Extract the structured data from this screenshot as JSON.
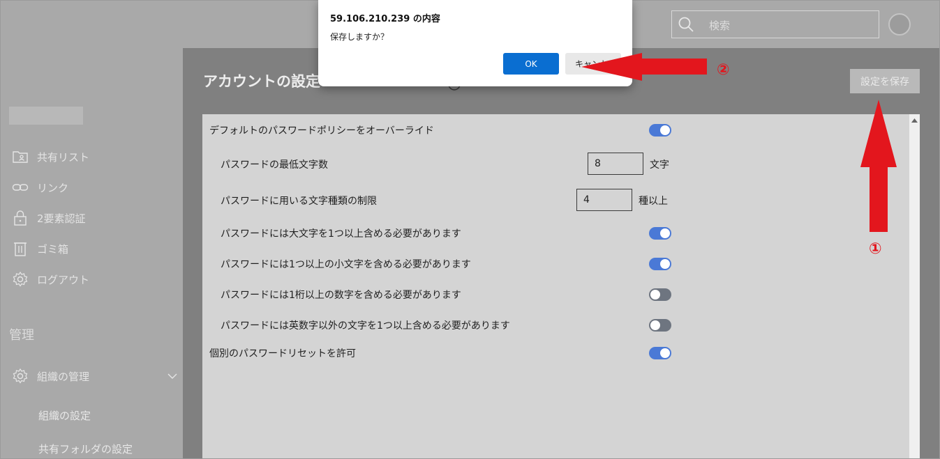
{
  "dialog": {
    "title": "59.106.210.239 の内容",
    "message": "保存しますか？",
    "ok_label": "OK",
    "cancel_label": "キャンセル"
  },
  "header": {
    "search_placeholder": "検索"
  },
  "sidebar": {
    "items": [
      {
        "label": "共有リスト",
        "icon": "shared-list-icon"
      },
      {
        "label": "リンク",
        "icon": "link-icon"
      },
      {
        "label": "2要素認証",
        "icon": "lock-icon"
      },
      {
        "label": "ゴミ箱",
        "icon": "trash-icon"
      },
      {
        "label": "ログアウト",
        "icon": "gear-icon"
      }
    ],
    "section_title": "管理",
    "org": {
      "label": "組織の管理",
      "icon": "gear-icon"
    },
    "sub_items": [
      "組織の設定",
      "共有フォルダの設定"
    ]
  },
  "main": {
    "title": "アカウントの設定",
    "save_label": "設定を保存",
    "settings": {
      "override_policy": {
        "label": "デフォルトのパスワードポリシーをオーバーライド",
        "on": true
      },
      "min_length": {
        "label": "パスワードの最低文字数",
        "value": "8",
        "unit": "文字"
      },
      "char_types": {
        "label": "パスワードに用いる文字種類の制限",
        "value": "4",
        "unit": "種以上"
      },
      "require_upper": {
        "label": "パスワードには大文字を1つ以上含める必要があります",
        "on": true
      },
      "require_lower": {
        "label": "パスワードには1つ以上の小文字を含める必要があります",
        "on": true
      },
      "require_digit": {
        "label": "パスワードには1桁以上の数字を含める必要があります",
        "on": false
      },
      "require_symbol": {
        "label": "パスワードには英数字以外の文字を1つ以上含める必要があります",
        "on": false
      },
      "allow_reset": {
        "label": "個別のパスワードリセットを許可",
        "on": true
      }
    }
  },
  "annotations": {
    "step1": "①",
    "step2": "②",
    "color": "#e3161d"
  },
  "colors": {
    "toggle_on": "#4a79d6",
    "toggle_off": "#6e7580",
    "ok_button": "#0a6ed1"
  }
}
